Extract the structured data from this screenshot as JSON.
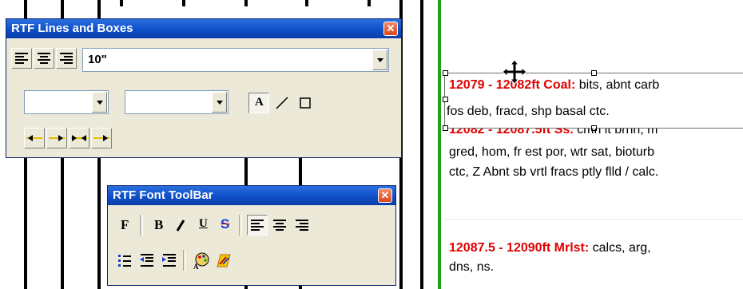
{
  "lines_window": {
    "title": "RTF Lines and Boxes",
    "size_value": "10\"",
    "style_value": "",
    "color_value": "",
    "text_tool": "A"
  },
  "font_window": {
    "title": "RTF Font ToolBar",
    "font_label": "F",
    "bold_label": "B",
    "italic_label": "I",
    "underline_label": "U",
    "strike_label": "S"
  },
  "entries": [
    {
      "range": "12079 - 12082ft Coal:",
      "desc": " bits, abnt carb",
      "line2": "fos deb, fracd, shp basal ctc."
    },
    {
      "range": "12082 - 12087.5ft Ss.",
      "desc": " cmn it brnn, m",
      "line2": "gred, hom, fr est por, wtr sat, bioturb",
      "line3": "ctc, Z Abnt sb vrtl fracs ptly flld / calc."
    },
    {
      "range": "12087.5 - 12090ft Mrlst:",
      "desc": " calcs, arg,",
      "line2": "dns, ns."
    }
  ]
}
